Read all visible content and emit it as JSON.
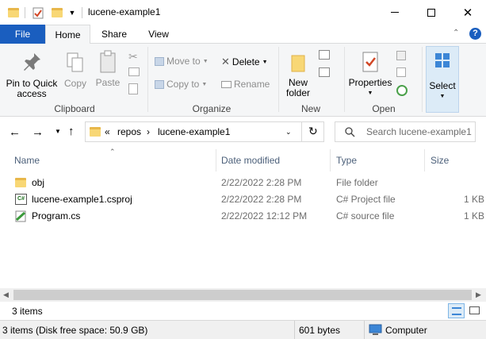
{
  "window": {
    "title": "lucene-example1"
  },
  "ribbon_tabs": [
    "File",
    "Home",
    "Share",
    "View"
  ],
  "ribbon": {
    "clipboard": {
      "label": "Clipboard",
      "pin": [
        "Pin to Quick",
        "access"
      ],
      "copy": "Copy",
      "paste": "Paste"
    },
    "organize": {
      "label": "Organize",
      "move_to": "Move to",
      "delete": "Delete",
      "copy_to": "Copy to",
      "rename": "Rename"
    },
    "new": {
      "label": "New",
      "new_folder": [
        "New",
        "folder"
      ]
    },
    "open": {
      "label": "Open",
      "properties": "Properties"
    },
    "select": {
      "label": "Select"
    }
  },
  "address": {
    "overflow": "«",
    "crumbs": [
      "repos",
      "lucene-example1"
    ]
  },
  "search": {
    "placeholder": "Search lucene-example1"
  },
  "columns": [
    "Name",
    "Date modified",
    "Type",
    "Size"
  ],
  "files": [
    {
      "name": "obj",
      "date": "2/22/2022 2:28 PM",
      "type": "File folder",
      "size": "",
      "icon": "folder-icon"
    },
    {
      "name": "lucene-example1.csproj",
      "date": "2/22/2022 2:28 PM",
      "type": "C# Project file",
      "size": "1 KB",
      "icon": "csproj-icon"
    },
    {
      "name": "Program.cs",
      "date": "2/22/2022 12:12 PM",
      "type": "C# source file",
      "size": "1 KB",
      "icon": "cs-file-icon"
    }
  ],
  "status": {
    "count": "3 items",
    "detail": "3 items (Disk free space: 50.9 GB)",
    "size": "601 bytes",
    "location": "Computer"
  },
  "colors": {
    "accent": "#1a5ebf",
    "folder": "#f8d775"
  }
}
